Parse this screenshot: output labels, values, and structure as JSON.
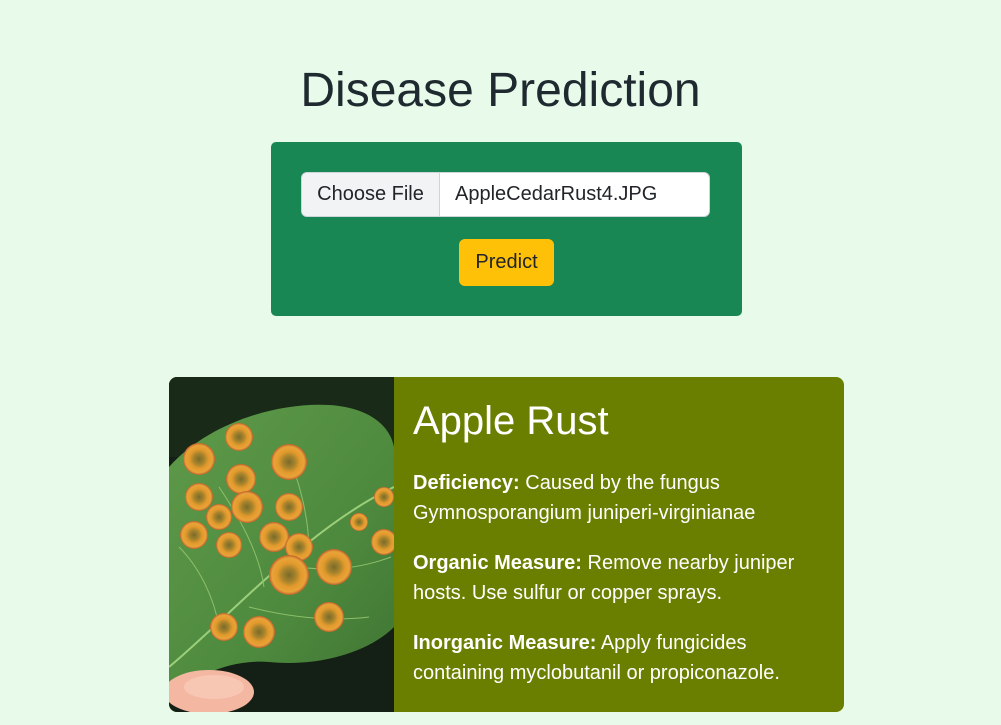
{
  "page": {
    "title": "Disease Prediction"
  },
  "upload": {
    "choose_file_label": "Choose File",
    "file_name": "AppleCedarRust4.JPG",
    "predict_label": "Predict"
  },
  "result": {
    "title": "Apple Rust",
    "deficiency_label": "Deficiency:",
    "deficiency_text": "Caused by the fungus Gymnosporangium juniperi-virginianae",
    "organic_label": "Organic Measure:",
    "organic_text": "Remove nearby juniper hosts. Use sulfur or copper sprays.",
    "inorganic_label": "Inorganic Measure:",
    "inorganic_text": "Apply fungicides containing myclobutanil or propiconazole."
  },
  "colors": {
    "background": "#e8fae9",
    "panel": "#198754",
    "predict_button": "#ffc107",
    "result_card": "#6a7f00"
  }
}
